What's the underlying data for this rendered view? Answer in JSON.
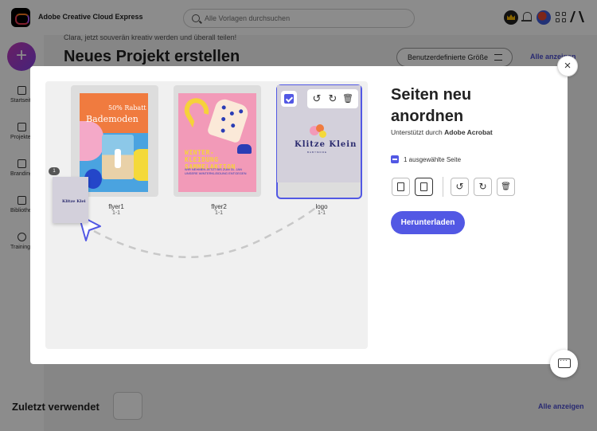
{
  "app": {
    "title": "Adobe Creative Cloud Express"
  },
  "search": {
    "placeholder": "Alle Vorlagen durchsuchen"
  },
  "background": {
    "greeting": "Clara, jetzt souverän kreativ werden und überall teilen!",
    "heading": "Neues Projekt erstellen",
    "custom_size_button": "Benutzerdefinierte Größe",
    "see_all_top": "Alle anzeigen",
    "recent_title": "Zuletzt verwendet",
    "see_all_bottom": "Alle anzeigen"
  },
  "sidebar": {
    "create_label": "+",
    "items": [
      {
        "label": "Startseite",
        "icon": "home-icon"
      },
      {
        "label": "Projekte",
        "icon": "file-icon"
      },
      {
        "label": "Branding",
        "icon": "brand-icon"
      },
      {
        "label": "Bibliotheken",
        "icon": "library-icon"
      },
      {
        "label": "Training",
        "icon": "bulb-icon"
      }
    ]
  },
  "modal": {
    "title": "Seiten neu anordnen",
    "supported_prefix": "Unterstützt durch",
    "supported_by": "Adobe Acrobat",
    "selected_label": "1 ausgewählte Seite",
    "download_button": "Herunterladen",
    "close_label": "×",
    "pages": [
      {
        "name": "flyer1",
        "pages": "1-1"
      },
      {
        "name": "flyer2",
        "pages": "1-1"
      },
      {
        "name": "logo",
        "pages": "1-1",
        "selected": true
      }
    ],
    "drag_count": "1",
    "flyer1": {
      "discount": "50% Rabatt",
      "headline": "Bademoden"
    },
    "flyer2": {
      "headline": "WINTER-\nKLEIDUNG\nSAMMELAKTION",
      "body": "WIR NEHMEN JETZT BIS ZUM 31. JAN UNSERE WINTERKLEIDUNG ENTGEGEN"
    },
    "logo": {
      "text": "Klitze Klein",
      "sub": "BABYMODE"
    },
    "ghost_text": "Klitze Klei"
  },
  "colors": {
    "accent": "#5258e4",
    "link": "#4c4ecf"
  }
}
